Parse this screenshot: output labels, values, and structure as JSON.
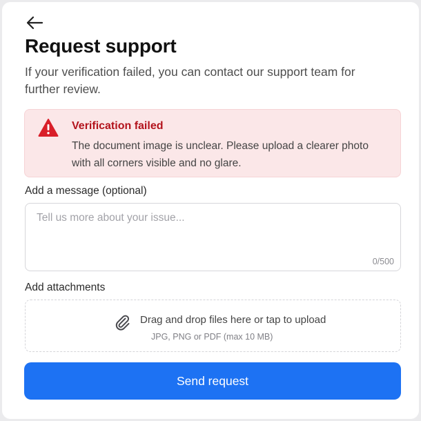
{
  "colors": {
    "accent": "#1d72f3",
    "error": "#b3131c",
    "error_background": "#fbe7e8"
  },
  "header": {
    "back_icon": "arrow-left-icon",
    "title": "Request support",
    "subtitle": "If your verification failed, you can contact our support team for further review."
  },
  "alert": {
    "icon": "warning-triangle-icon",
    "title": "Verification failed",
    "message": "The document image is unclear. Please upload a clearer photo with all corners visible and no glare."
  },
  "message": {
    "label": "Add a message (optional)",
    "value": "",
    "placeholder": "Tell us more about your issue...",
    "counter": "0/500"
  },
  "attachments": {
    "label": "Add attachments",
    "icon": "paperclip-icon",
    "prompt": "Drag and drop files here or tap to upload",
    "hint": "JPG, PNG or PDF (max 10 MB)"
  },
  "submit": {
    "label": "Send request"
  }
}
